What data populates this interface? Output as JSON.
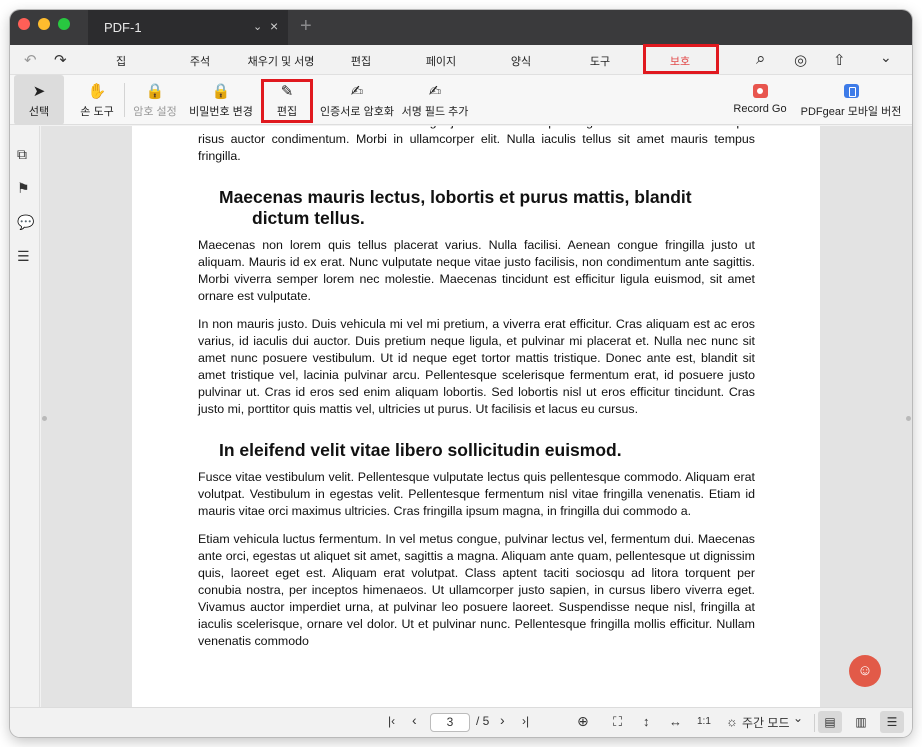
{
  "titlebar": {
    "tab_title": "PDF-1",
    "tab_chevron": "⌄",
    "tab_close": "×",
    "new_tab": "+"
  },
  "menu": {
    "undo": "↶",
    "redo": "↷",
    "items": [
      "집",
      "주석",
      "채우기 및 서명",
      "편집",
      "페이지",
      "양식",
      "도구",
      "보호"
    ],
    "active_item": "보호",
    "search_icon": "⌕",
    "help_icon": "◎",
    "share_icon": "⇧",
    "more_icon": "⌄"
  },
  "toolbar": {
    "select": {
      "icon": "➤",
      "label": "선택"
    },
    "hand": {
      "icon": "✋",
      "label": "손 도구"
    },
    "set_password": {
      "icon": "🔒",
      "label": "암호 설정"
    },
    "change_password": {
      "icon": "🔒",
      "label": "비밀번호 변경"
    },
    "edit": {
      "icon": "✎",
      "label": "편집"
    },
    "cert_encrypt": {
      "icon": "✍",
      "label": "인증서로 암호화"
    },
    "add_signature_field": {
      "icon": "✍",
      "label": "서명 필드 추가"
    },
    "record_go": {
      "label": "Record Go"
    },
    "mobile_version": {
      "label": "PDFgear 모바일 버전"
    }
  },
  "sidebar": {
    "pages_icon": "⧉",
    "bookmark_icon": "⚑",
    "comments_icon": "💬",
    "outline_icon": "☰"
  },
  "document": {
    "p0": "ac accumsan nunc vehicula vitae. Nulla eget justo in felis tristique fringilla. Morbi sit amet tortor quis risus auctor condimentum. Morbi in ullamcorper elit. Nulla iaculis tellus sit amet mauris tempus fringilla.",
    "h1_line1": "Maecenas mauris lectus, lobortis et purus mattis, blandit",
    "h1_line2": "dictum tellus.",
    "p1": "Maecenas non lorem quis tellus placerat varius. Nulla facilisi. Aenean congue fringilla justo ut aliquam. Mauris id ex erat. Nunc vulputate neque vitae justo facilisis, non condimentum ante sagittis. Morbi viverra semper lorem nec molestie. Maecenas tincidunt est efficitur ligula euismod, sit amet ornare est vulputate.",
    "p2": "In non mauris justo. Duis vehicula mi vel mi pretium, a viverra erat efficitur. Cras aliquam est ac eros varius, id iaculis dui auctor. Duis pretium neque ligula, et pulvinar mi placerat et. Nulla nec nunc sit amet nunc posuere vestibulum. Ut id neque eget tortor mattis tristique. Donec ante est, blandit sit amet tristique vel, lacinia pulvinar arcu. Pellentesque scelerisque fermentum erat, id posuere justo pulvinar ut. Cras id eros sed enim aliquam lobortis. Sed lobortis nisl ut eros efficitur tincidunt. Cras justo mi, porttitor quis mattis vel, ultricies ut purus. Ut facilisis et lacus eu cursus.",
    "h2": "In eleifend velit vitae libero sollicitudin euismod.",
    "p3": "Fusce vitae vestibulum velit. Pellentesque vulputate lectus quis pellentesque commodo. Aliquam erat volutpat. Vestibulum in egestas velit. Pellentesque fermentum nisl vitae fringilla venenatis. Etiam id mauris vitae orci maximus ultricies. Cras fringilla ipsum magna, in fringilla dui commodo a.",
    "p4": "Etiam vehicula luctus fermentum. In vel metus congue, pulvinar lectus vel, fermentum dui. Maecenas ante orci, egestas ut aliquet sit amet, sagittis a magna. Aliquam ante quam, pellentesque ut dignissim quis, laoreet eget est. Aliquam erat volutpat. Class aptent taciti sociosqu ad litora torquent per conubia nostra, per inceptos himenaeos. Ut ullamcorper justo sapien, in cursus libero viverra eget. Vivamus auctor imperdiet urna, at pulvinar leo posuere laoreet. Suspendisse neque nisl, fringilla at iaculis scelerisque, ornare vel dolor. Ut et pulvinar nunc. Pellentesque fringilla mollis efficitur. Nullam venenatis commodo"
  },
  "ai_assistant_icon": "☺",
  "bottombar": {
    "first_page": "|‹",
    "prev_page": "‹",
    "current_page": "3",
    "total_pages": "/ 5",
    "next_page": "›",
    "last_page": "›|",
    "zoom_in_icon": "⊕",
    "fit_page_icon": "⛶",
    "fit_height_icon": "↕",
    "fit_width_icon": "↔",
    "actual_size_label": "1:1",
    "theme_icon": "☼",
    "theme_label": "주간 모드",
    "theme_chevron": "⌄",
    "single_page_icon": "▤",
    "two_page_icon": "▥",
    "scroll_icon": "☰"
  },
  "colors": {
    "accent_red": "#e0191f",
    "protect_tab_text": "#e24c4c",
    "titlebar": "#3a3a3c",
    "record_icon": "#e8554e",
    "mobile_icon": "#3d7be8",
    "ai_fab": "#e25a48"
  }
}
